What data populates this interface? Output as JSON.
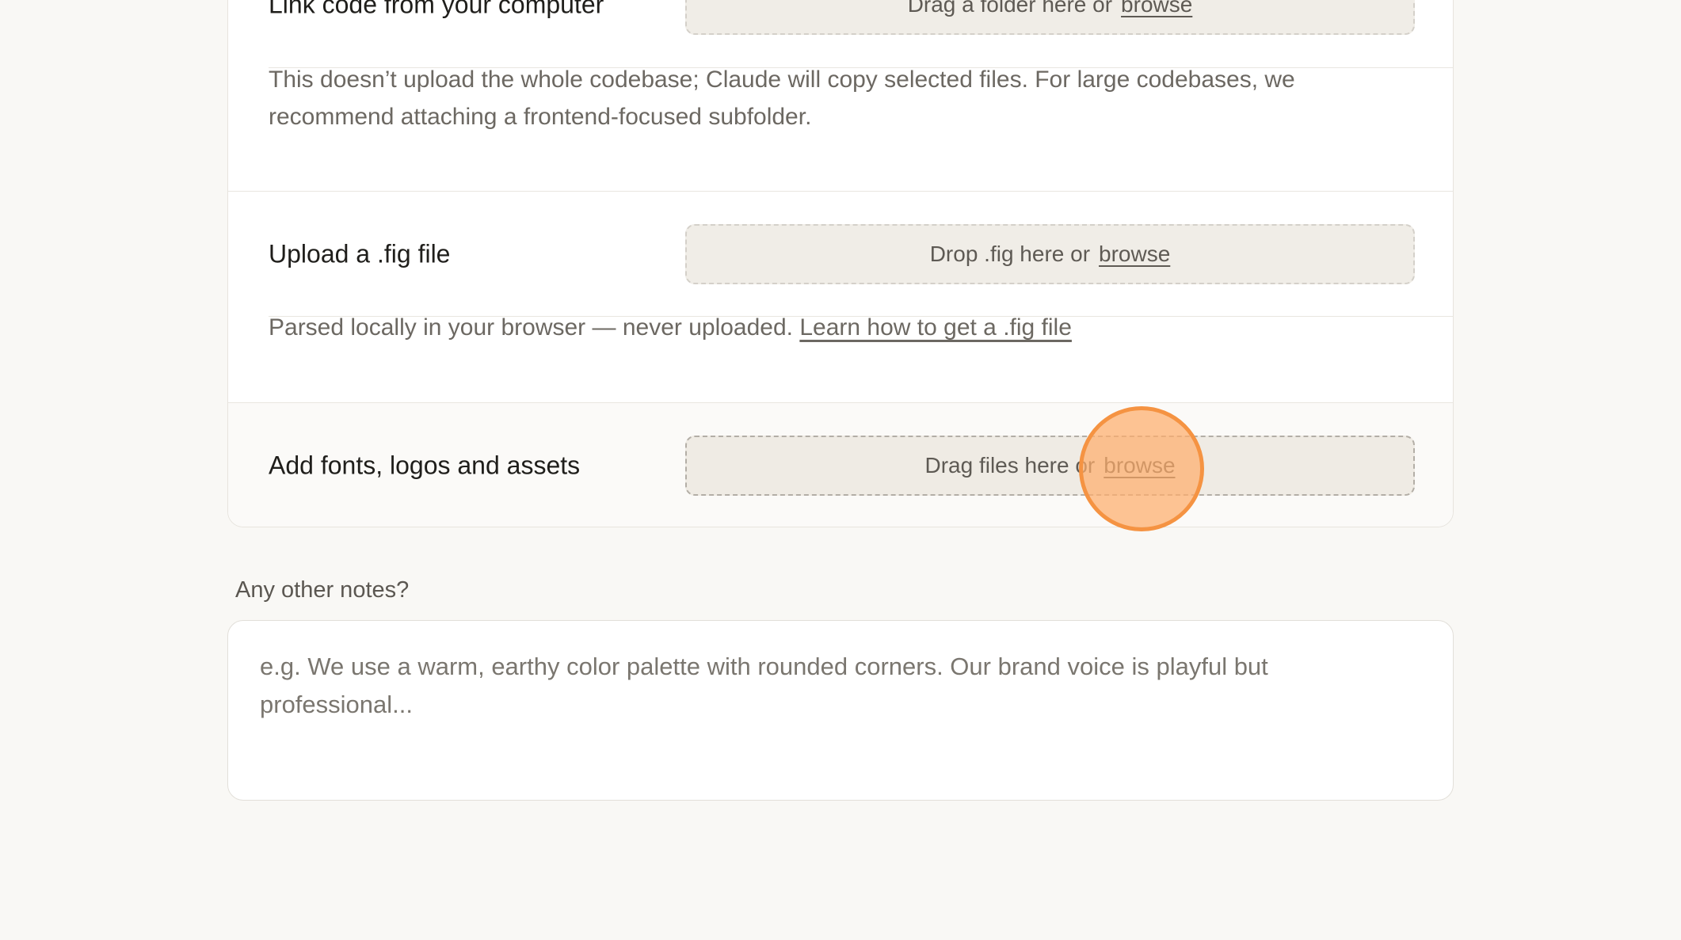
{
  "link_code": {
    "label": "Link code from your computer",
    "dropzone_text": "Drag a folder here or",
    "browse_label": "browse",
    "note": "This doesn’t upload the whole codebase; Claude will copy selected files. For large codebases, we recommend attaching a frontend-focused subfolder."
  },
  "fig_upload": {
    "label": "Upload a .fig file",
    "dropzone_text": "Drop .fig here or",
    "browse_label": "browse",
    "note": "Parsed locally in your browser — never uploaded.",
    "note_link": "Learn how to get a .fig file"
  },
  "assets": {
    "label": "Add fonts, logos and assets",
    "dropzone_text": "Drag files here or",
    "browse_label": "browse"
  },
  "notes": {
    "label": "Any other notes?",
    "placeholder": "e.g. We use a warm, earthy color palette with rounded corners. Our brand voice is playful but professional...",
    "value": ""
  },
  "cursor": {
    "indicator": "click-highlight",
    "color": "#f59342"
  }
}
